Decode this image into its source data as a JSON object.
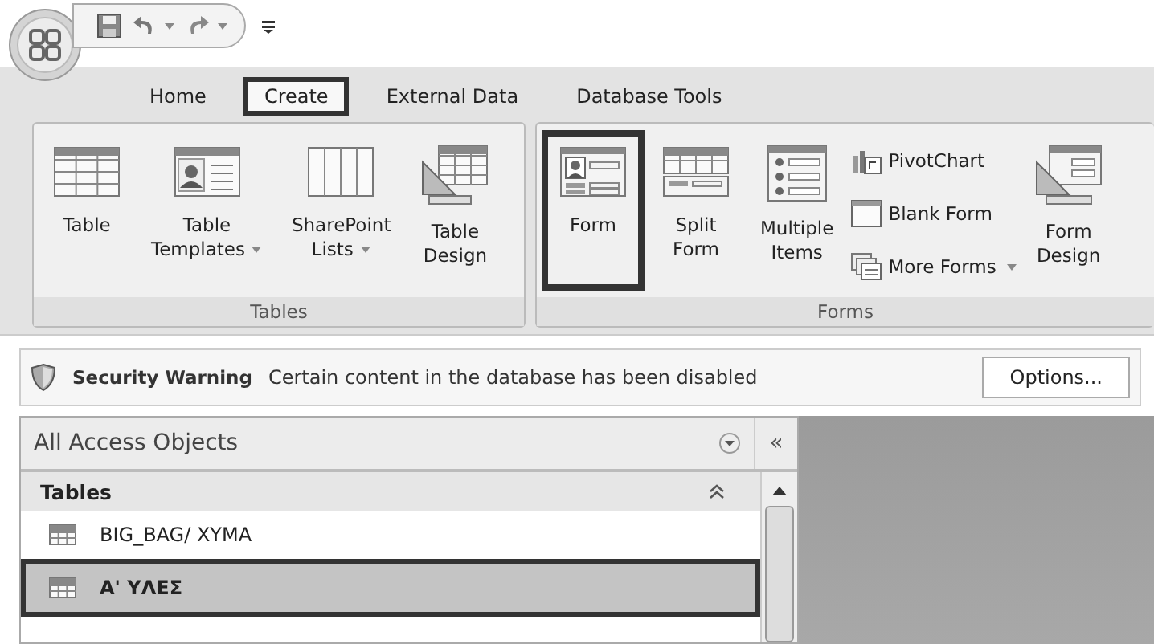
{
  "quick_access": {
    "buttons": [
      {
        "menu": false
      },
      {
        "menu": true
      },
      {
        "menu": true
      }
    ]
  },
  "tabs": [
    {
      "label": "Home",
      "selected": false,
      "outlined": false
    },
    {
      "label": "Create",
      "selected": true,
      "outlined": true
    },
    {
      "label": "External Data",
      "selected": false,
      "outlined": false
    },
    {
      "label": "Database Tools",
      "selected": false,
      "outlined": false
    }
  ],
  "ribbon_groups": [
    {
      "label": "Tables",
      "buttons": [
        {
          "kind": "large",
          "lines": [
            "Table"
          ],
          "dropdown": false,
          "outlined": false
        },
        {
          "kind": "large",
          "lines": [
            "Table",
            "Templates"
          ],
          "dropdown": true,
          "outlined": false
        },
        {
          "kind": "large",
          "lines": [
            "SharePoint",
            "Lists"
          ],
          "dropdown": true,
          "outlined": false
        },
        {
          "kind": "large",
          "lines": [
            "Table",
            "Design"
          ],
          "dropdown": false,
          "outlined": false
        }
      ]
    },
    {
      "label": "Forms",
      "buttons": [
        {
          "kind": "large",
          "lines": [
            "Form"
          ],
          "dropdown": false,
          "outlined": true
        },
        {
          "kind": "large",
          "lines": [
            "Split",
            "Form"
          ],
          "dropdown": false,
          "outlined": false
        },
        {
          "kind": "large",
          "lines": [
            "Multiple",
            "Items"
          ],
          "dropdown": false,
          "outlined": false
        },
        {
          "kind": "stack",
          "items": [
            {
              "label": "PivotChart",
              "dropdown": false
            },
            {
              "label": "Blank Form",
              "dropdown": false
            },
            {
              "label": "More Forms",
              "dropdown": true
            }
          ]
        },
        {
          "kind": "large",
          "lines": [
            "Form",
            "Design"
          ],
          "dropdown": false,
          "outlined": false
        }
      ]
    }
  ],
  "message_bar": {
    "title": "Security Warning",
    "text": "Certain content in the database has been disabled",
    "button": "Options..."
  },
  "nav_pane": {
    "title": "All Access Objects",
    "collapse": "«",
    "sections": [
      {
        "label": "Tables",
        "expanded": true,
        "items": [
          {
            "label": "BIG_BAG/ XYMA",
            "selected": false,
            "outlined": false
          },
          {
            "label": "Α' ΥΛΕΣ",
            "selected": true,
            "outlined": true
          }
        ]
      }
    ]
  }
}
